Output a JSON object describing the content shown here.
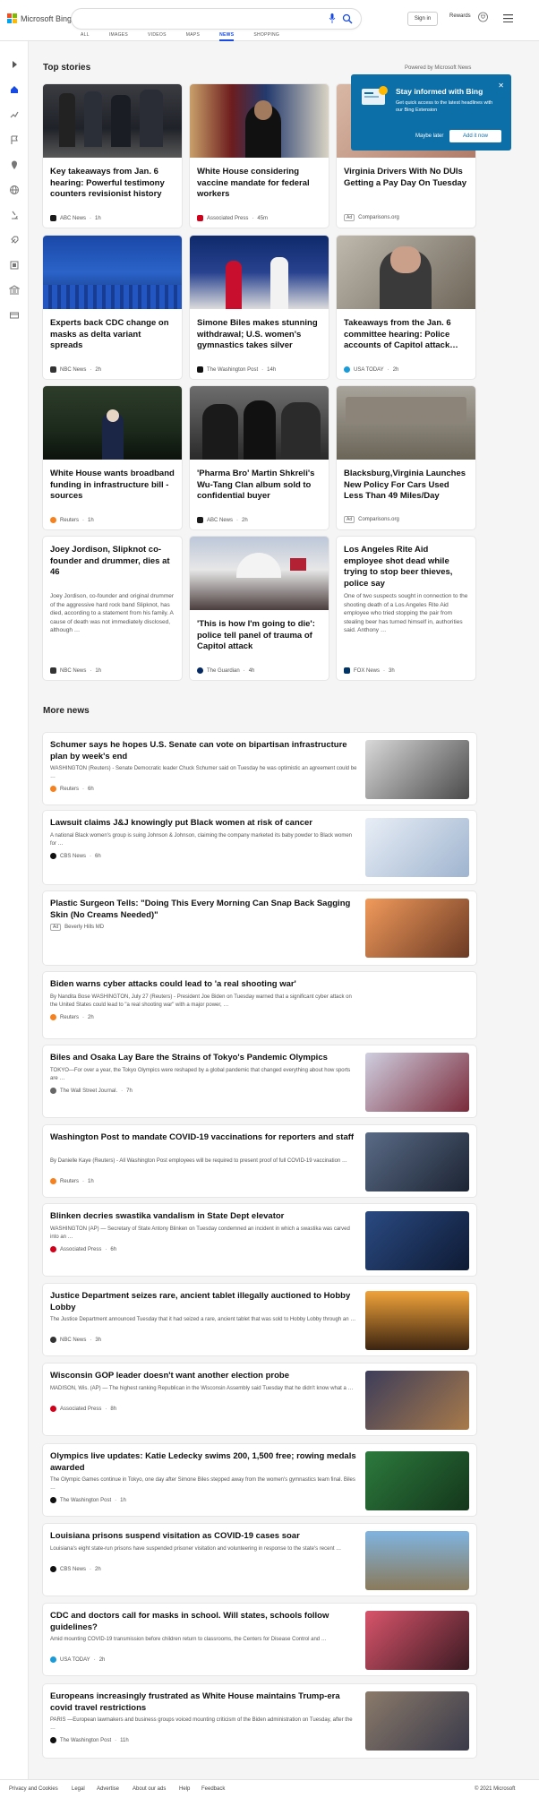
{
  "header": {
    "logo_text": "Microsoft Bing",
    "signin": "Sign in",
    "rewards": "Rewards",
    "tabs": [
      "ALL",
      "IMAGES",
      "VIDEOS",
      "MAPS",
      "NEWS",
      "SHOPPING"
    ],
    "active_tab": "NEWS"
  },
  "top_stories": {
    "title": "Top stories",
    "powered": "Powered by Microsoft News",
    "cards": [
      {
        "title": "Key takeaways from Jan. 6 hearing: Powerful testimony counters revisionist history",
        "source": "ABC News",
        "time": "1h"
      },
      {
        "title": "White House considering vaccine mandate for federal workers",
        "source": "Associated Press",
        "time": "45m"
      },
      {
        "title": "Virginia Drivers With No DUIs Getting a Pay Day On Tuesday",
        "source": "Comparisons.org",
        "ad": "Ad"
      },
      {
        "title": "Experts back CDC change on masks as delta variant spreads",
        "source": "NBC News",
        "time": "2h"
      },
      {
        "title": "Simone Biles makes stunning withdrawal; U.S. women's gymnastics takes silver",
        "source": "The Washington Post",
        "time": "14h"
      },
      {
        "title": "Takeaways from the Jan. 6 committee hearing: Police accounts of Capitol attack…",
        "source": "USA TODAY",
        "time": "2h"
      },
      {
        "title": "White House wants broadband funding in infrastructure bill - sources",
        "source": "Reuters",
        "time": "1h"
      },
      {
        "title": "'Pharma Bro' Martin Shkreli's Wu-Tang Clan album sold to confidential buyer",
        "source": "ABC News",
        "time": "2h"
      },
      {
        "title": "Blacksburg,Virginia Launches New Policy For Cars Used Less Than 49 Miles/Day",
        "source": "Comparisons.org",
        "ad": "Ad"
      },
      {
        "title": "Joey Jordison, Slipknot co-founder and drummer, dies at 46",
        "snippet": "Joey Jordison, co-founder and original drummer of the aggressive hard rock band Slipknot, has died, according to a statement from his family. A cause of death was not immediately disclosed, although …",
        "source": "NBC News",
        "time": "1h"
      },
      {
        "title": "'This is how I'm going to die': police tell panel of trauma of Capitol attack",
        "source": "The Guardian",
        "time": "4h"
      },
      {
        "title": "Los Angeles Rite Aid employee shot dead while trying to stop beer thieves, police say",
        "snippet": "One of two suspects sought in connection to the shooting death of a Los Angeles Rite Aid employee who tried stopping the pair from stealing beer has turned himself in, authorities said.  Anthony …",
        "source": "FOX News",
        "time": "3h"
      }
    ]
  },
  "popup": {
    "title": "Stay informed with Bing",
    "desc": "Get quick access to the latest headlines with our Bing Extension",
    "later": "Maybe later",
    "add": "Add it now",
    "close": "✕"
  },
  "more_news": {
    "title": "More news",
    "items": [
      {
        "title": "Schumer says he hopes U.S. Senate can vote on bipartisan infrastructure plan by week's end",
        "snippet": "WASHINGTON (Reuters) - Senate Democratic leader Chuck Schumer said on Tuesday he was optimistic an agreement could be …",
        "source": "Reuters",
        "time": "6h"
      },
      {
        "title": "Lawsuit claims J&J knowingly put Black women at risk of cancer",
        "snippet": "A national Black women's group is suing Johnson & Johnson, claiming the company marketed its baby powder to Black women for …",
        "source": "CBS News",
        "time": "6h"
      },
      {
        "title": "Plastic Surgeon Tells: \"Doing This Every Morning Can Snap Back Sagging Skin (No Creams Needed)\"",
        "snippet": "",
        "source": "Beverly Hills MD",
        "ad": "Ad"
      },
      {
        "title": "Biden warns cyber attacks could lead to 'a real shooting war'",
        "snippet": "By Nandita Bose WASHINGTON, July 27 (Reuters) - President Joe Biden on Tuesday warned that a significant cyber attack on the United States could lead to \"a real shooting war\" with a major power, …",
        "source": "Reuters",
        "time": "2h"
      },
      {
        "title": "Biles and Osaka Lay Bare the Strains of Tokyo's Pandemic Olympics",
        "snippet": "TOKYO—For over a year, the Tokyo Olympics were reshaped by a global pandemic that changed everything about how sports are …",
        "source": "The Wall Street Journal.",
        "time": "7h"
      },
      {
        "title": "Washington Post to mandate COVID-19 vaccinations for reporters and staff",
        "snippet": "By Danielle Kaye (Reuters) - All Washington Post employees will be required to present proof of full COVID-19 vaccination …",
        "source": "Reuters",
        "time": "1h"
      },
      {
        "title": "Blinken decries swastika vandalism in State Dept elevator",
        "snippet": "WASHINGTON (AP) — Secretary of State Antony Blinken on Tuesday condemned an incident in which a swastika was carved into an …",
        "source": "Associated Press",
        "time": "6h"
      },
      {
        "title": "Justice Department seizes rare, ancient tablet illegally auctioned to Hobby Lobby",
        "snippet": "The Justice Department announced Tuesday that it had seized a rare, ancient tablet that was sold to Hobby Lobby through an …",
        "source": "NBC News",
        "time": "3h"
      },
      {
        "title": "Wisconsin GOP leader doesn't want another election probe",
        "snippet": "MADISON, Wis. (AP) — The highest ranking Republican in the Wisconsin Assembly said Tuesday that he didn't know what a …",
        "source": "Associated Press",
        "time": "8h"
      },
      {
        "title": "Olympics live updates: Katie Ledecky swims 200, 1,500 free; rowing medals awarded",
        "snippet": "The Olympic Games continue in Tokyo, one day after Simone Biles stepped away from the women's gymnastics team final. Biles …",
        "source": "The Washington Post",
        "time": "1h"
      },
      {
        "title": "Louisiana prisons suspend visitation as COVID-19 cases soar",
        "snippet": "Louisiana's eight state-run prisons have suspended prisoner visitation and volunteering in response to the state's recent …",
        "source": "CBS News",
        "time": "2h"
      },
      {
        "title": "CDC and doctors call for masks in school. Will states, schools follow guidelines?",
        "snippet": "Amid mounting COVID-19 transmission before children return to classrooms, the Centers for Disease Control and …",
        "source": "USA TODAY",
        "time": "2h"
      },
      {
        "title": "Europeans increasingly frustrated as White House maintains Trump-era covid travel restrictions",
        "snippet": "PARIS —European lawmakers and business groups voiced mounting criticism of the Biden administration on Tuesday, after the …",
        "source": "The Washington Post",
        "time": "11h"
      }
    ]
  },
  "footer": {
    "links": [
      "Privacy and Cookies",
      "Legal",
      "Advertise",
      "About our ads",
      "Help",
      "Feedback"
    ],
    "copyright": "© 2021 Microsoft"
  }
}
